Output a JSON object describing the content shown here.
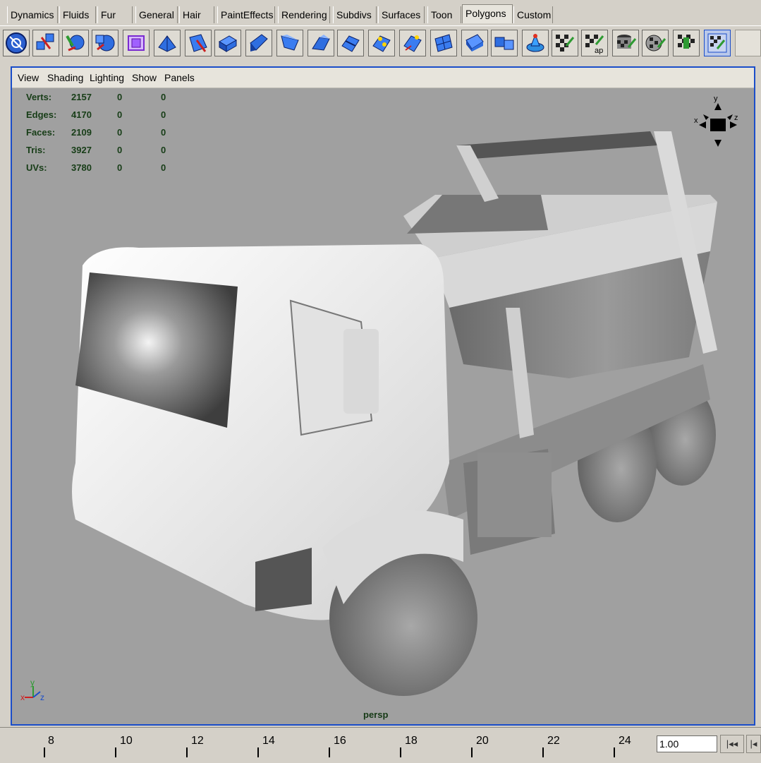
{
  "shelf_tabs": [
    {
      "label": "Dynamics"
    },
    {
      "label": "Fluids"
    },
    {
      "label": "Fur"
    },
    {
      "label": "General"
    },
    {
      "label": "Hair"
    },
    {
      "label": "PaintEffects"
    },
    {
      "label": "Rendering"
    },
    {
      "label": "Subdivs"
    },
    {
      "label": "Surfaces"
    },
    {
      "label": "Toon"
    },
    {
      "label": "Polygons",
      "active": true
    },
    {
      "label": "Custom"
    }
  ],
  "shelf_icons": [
    "poly-select-icon",
    "combine-icon",
    "separate-icon",
    "poly-sphere-icon",
    "smooth-proxy-icon",
    "poly-cube-icon",
    "poly-plane-icon",
    "extrude-face-icon",
    "extrude-edge-icon",
    "bevel-icon",
    "wedge-face-icon",
    "split-polygon-icon",
    "merge-vertices-icon",
    "append-polygon-icon",
    "subdivide-icon",
    "poke-face-icon",
    "duplicate-face-icon",
    "extract-icon",
    "cone-icon",
    "planar-mapping-icon",
    "automatic-mapping-icon",
    "cylindrical-mapping-icon",
    "spherical-mapping-icon",
    "texture-editor-icon",
    "uv-snapshot-icon"
  ],
  "shelf_labels": {
    "automatic_mapping_suffix": "ap"
  },
  "viewport_menu": [
    {
      "label": "View"
    },
    {
      "label": "Shading"
    },
    {
      "label": "Lighting"
    },
    {
      "label": "Show"
    },
    {
      "label": "Panels"
    }
  ],
  "stats": [
    {
      "label": "Verts:",
      "total": "2157",
      "selected": "0",
      "third": "0"
    },
    {
      "label": "Edges:",
      "total": "4170",
      "selected": "0",
      "third": "0"
    },
    {
      "label": "Faces:",
      "total": "2109",
      "selected": "0",
      "third": "0"
    },
    {
      "label": "Tris:",
      "total": "3927",
      "selected": "0",
      "third": "0"
    },
    {
      "label": "UVs:",
      "total": "3780",
      "selected": "0",
      "third": "0"
    }
  ],
  "view_cube": {
    "x": "x",
    "y": "y",
    "z": "z"
  },
  "axis_gizmo": {
    "x": "x",
    "y": "y",
    "z": "z"
  },
  "camera_label": "persp",
  "timeline": {
    "ticks": [
      "8",
      "10",
      "12",
      "14",
      "16",
      "18",
      "20",
      "22",
      "24"
    ],
    "current_frame": "1.00",
    "buttons": [
      "go-to-start-icon",
      "step-back-icon"
    ]
  },
  "colors": {
    "viewport_bg": "#a0a0a0",
    "viewport_border": "#1a4dc9",
    "stats_text": "#173d17",
    "ui_bg": "#d4d0c8"
  }
}
